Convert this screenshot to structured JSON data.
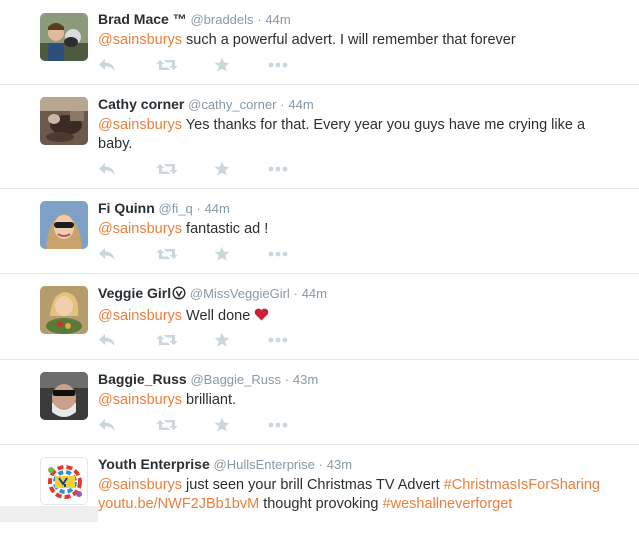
{
  "tweets": [
    {
      "fullname": "Brad Mace ™",
      "username": "@braddels",
      "sep": "·",
      "time": "44m",
      "mention": "@sainsburys",
      "text": " such a powerful advert. I will remember that forever"
    },
    {
      "fullname": "Cathy corner",
      "username": "@cathy_corner",
      "sep": "·",
      "time": "44m",
      "mention": "@sainsburys",
      "text": " Yes thanks for that. Every year you guys have me crying like a baby."
    },
    {
      "fullname": "Fi Quinn",
      "username": "@fi_q",
      "sep": "·",
      "time": "44m",
      "mention": "@sainsburys",
      "text": " fantastic ad !"
    },
    {
      "fullname": "Veggie Girl",
      "username": "@MissVeggieGirl",
      "sep": "·",
      "time": "44m",
      "mention": "@sainsburys",
      "text": " Well done "
    },
    {
      "fullname": "Baggie_Russ",
      "username": "@Baggie_Russ",
      "sep": "·",
      "time": "43m",
      "mention": "@sainsburys",
      "text": " brilliant."
    },
    {
      "fullname": "Youth Enterprise",
      "username": "@HullsEnterprise",
      "sep": "·",
      "time": "43m",
      "mention": "@sainsburys",
      "text": " just seen your brill Christmas TV Advert  ",
      "hashtag1": "#ChristmasIsForSharing",
      "link": "youtu.be/NWF2JBb1bvM",
      "text2": " thought provoking ",
      "hashtag2": "#weshallneverforget"
    }
  ],
  "icons": {
    "reply": "reply-icon",
    "retweet": "retweet-icon",
    "favorite": "star-icon",
    "more": "more-icon",
    "verified": "verified-icon",
    "heart": "heart-icon"
  },
  "colors": {
    "link": "#e8813e",
    "meta": "#8899a6",
    "action": "#ccd6dd",
    "divider": "#e1e8ed",
    "heart": "#cc1f3a"
  }
}
